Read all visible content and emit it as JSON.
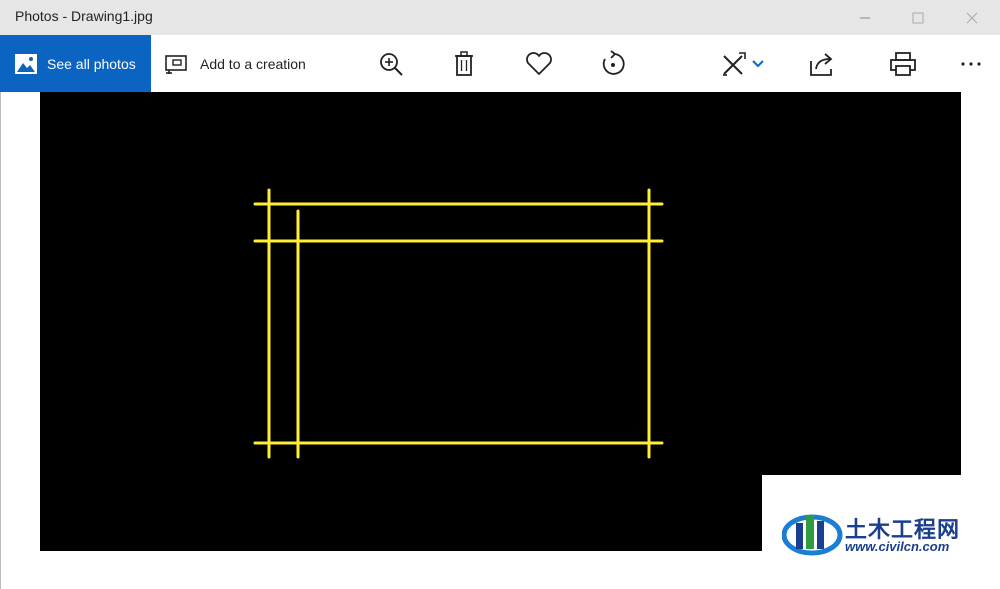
{
  "window": {
    "title": "Photos - Drawing1.jpg",
    "controls": [
      "minimize",
      "maximize",
      "close"
    ]
  },
  "toolbar": {
    "see_all_label": "See all photos",
    "add_creation_label": "Add to a creation",
    "buttons": [
      "zoom-in-icon",
      "delete-icon",
      "favorite-icon",
      "rotate-icon",
      "edit-draw-icon",
      "share-icon",
      "print-icon",
      "more-icon"
    ]
  },
  "image": {
    "background_color": "#000000",
    "line_color": "#ffee33",
    "description_lines": "CAD rectangle frame"
  },
  "watermark": {
    "brand": "土木工程网",
    "url": "www.civilcn.com"
  },
  "colors": {
    "accent": "#0b63c2",
    "titlebar": "#e6e6e6"
  }
}
